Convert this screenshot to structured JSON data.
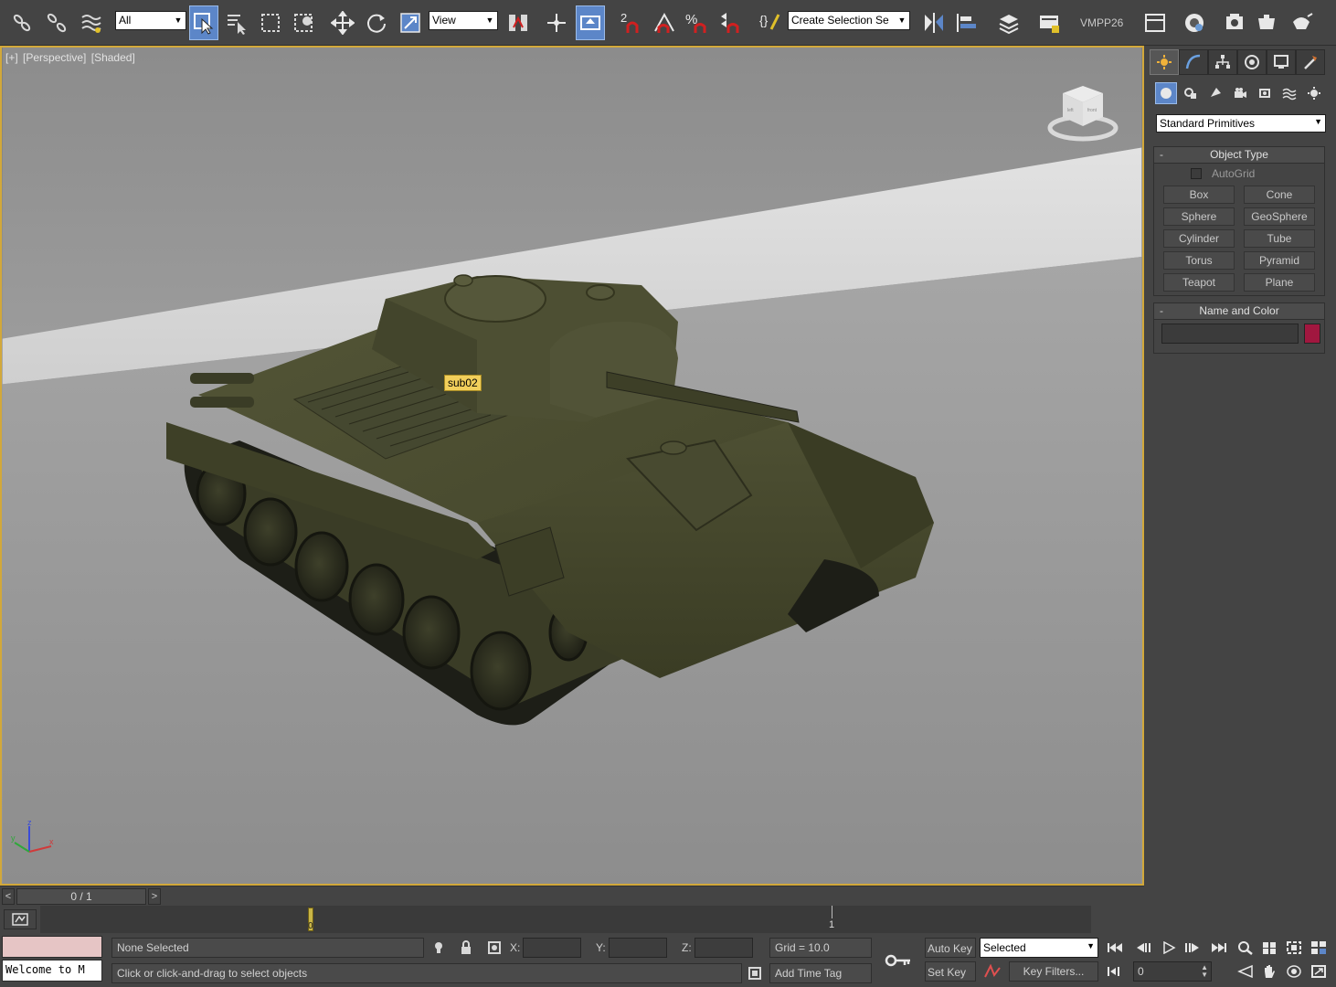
{
  "toolbar": {
    "selection_filter": "All",
    "ref_coord_system": "View",
    "named_selection_placeholder": "Create Selection Se",
    "snaps_angle_label": "%",
    "vmpp_label": "VMPP26"
  },
  "viewport": {
    "label_plus": "[+]",
    "label_view": "[Perspective]",
    "label_shading": "[Shaded]",
    "viewcube_left": "left",
    "viewcube_front": "front",
    "object_tag": "sub02",
    "axis_x": "x",
    "axis_y": "y",
    "axis_z": "z"
  },
  "command_panel": {
    "primitive_category": "Standard Primitives",
    "object_type": {
      "title": "Object Type",
      "collapse": "-",
      "autogrid": "AutoGrid",
      "buttons": [
        "Box",
        "Cone",
        "Sphere",
        "GeoSphere",
        "Cylinder",
        "Tube",
        "Torus",
        "Pyramid",
        "Teapot",
        "Plane"
      ]
    },
    "name_and_color": {
      "title": "Name and Color",
      "collapse": "-",
      "color": "#a1173f"
    }
  },
  "time_slider": {
    "frame_display": "0 / 1",
    "prev": "<",
    "next": ">"
  },
  "trackbar": {
    "key_label": "0",
    "tick_label": "1"
  },
  "status": {
    "maxscript_listener": "Welcome to M",
    "selection": "None Selected",
    "prompt": "Click or click-and-drag to select objects",
    "x_label": "X:",
    "y_label": "Y:",
    "z_label": "Z:",
    "grid": "Grid = 10.0",
    "add_time_tag": "Add Time Tag",
    "auto_key": "Auto Key",
    "set_key": "Set Key",
    "key_mode": "Selected",
    "key_filters": "Key Filters...",
    "current_frame": "0"
  },
  "colors": {
    "accent": "#5c86c8",
    "viewport_border": "#d2a83a",
    "tank": "#4b4d30"
  }
}
